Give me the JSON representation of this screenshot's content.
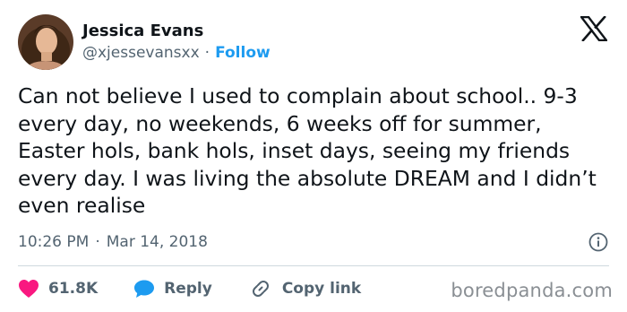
{
  "author": {
    "display_name": "Jessica Evans",
    "handle": "@xjessevansxx",
    "separator": "·",
    "follow_label": "Follow"
  },
  "tweet": {
    "text": "Can not believe I used to complain about school.. 9-3 every day, no weekends, 6 weeks off for summer, Easter hols, bank hols, inset days, seeing my friends every day. I was living the absolute DREAM and I didn’t even realise",
    "time": "10:26 PM",
    "separator": "·",
    "date": "Mar 14, 2018"
  },
  "actions": {
    "likes_count": "61.8K",
    "reply_label": "Reply",
    "copy_link_label": "Copy link"
  },
  "watermark": "boredpanda.com",
  "colors": {
    "accent": "#1d9bf0",
    "like": "#f91880",
    "text": "#0f1419",
    "muted": "#536471"
  },
  "icons": [
    "avatar-photo",
    "x-logo-icon",
    "info-icon",
    "heart-icon",
    "reply-bubble-icon",
    "link-icon"
  ]
}
